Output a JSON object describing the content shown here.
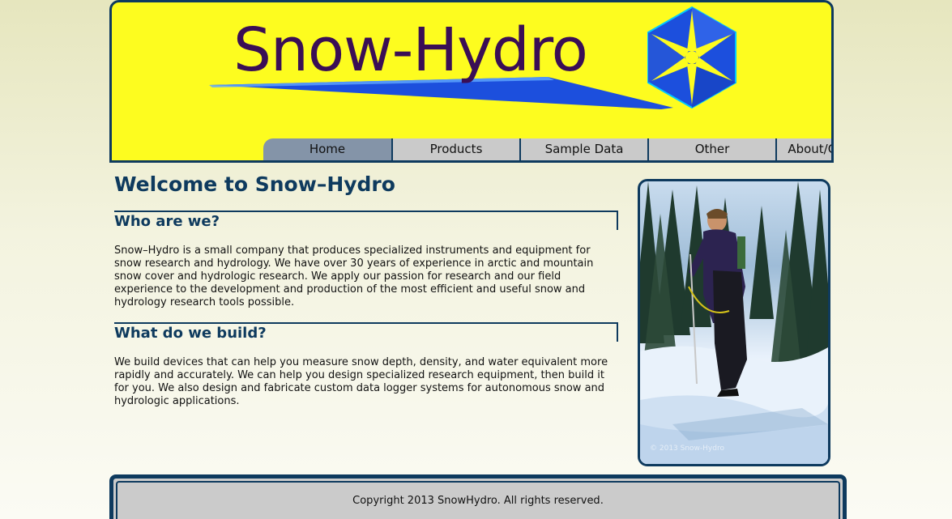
{
  "header": {
    "logo_text": "Snow-Hydro"
  },
  "nav": {
    "items": [
      {
        "label": "Home"
      },
      {
        "label": "Products"
      },
      {
        "label": "Sample Data"
      },
      {
        "label": "Other"
      },
      {
        "label": "About/Contact Us"
      }
    ]
  },
  "main": {
    "title": "Welcome to Snow–Hydro",
    "sections": [
      {
        "heading": "Who are we?",
        "body": "Snow–Hydro is a small company that produces specialized instruments and equipment for snow research and hydrology. We have over 30 years of experience in arctic and mountain snow cover and hydrologic research. We apply our passion for research and our field experience to the development and production of the most efficient and useful snow and hydrology research tools possible."
      },
      {
        "heading": "What do we build?",
        "body": "We build devices that can help you measure snow depth, density, and water equivalent more rapidly and accurately. We can help you design specialized research equipment, then build it for you. We also design and fabricate custom data logger systems for autonomous snow and hydrologic applications."
      }
    ]
  },
  "photo": {
    "watermark": "© 2013 Snow-Hydro"
  },
  "footer": {
    "copyright": "Copyright 2013 SnowHydro. All rights reserved."
  },
  "colors": {
    "header_bg": "#fdfc1f",
    "accent_navy": "#0e3a5e",
    "nav_bg": "#cacaca",
    "nav_active_bg": "#8494a8",
    "logo_text": "#3a0e55",
    "swoosh_blue": "#1c4fdd"
  }
}
